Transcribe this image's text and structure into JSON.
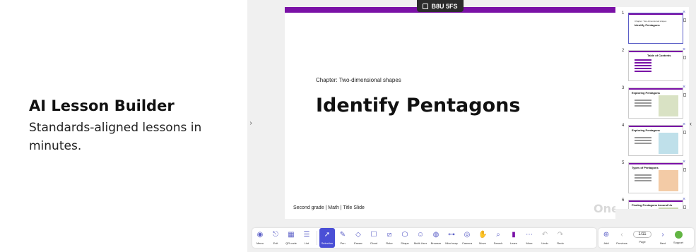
{
  "promo": {
    "title": "AI Lesson Builder",
    "subtitle": "Standards-aligned lessons in minutes."
  },
  "room_code": "B8U 5FS",
  "slide": {
    "chapter": "Chapter: Two-dimensional shapes",
    "title": "Identify Pentagons",
    "footer": "Second grade | Math | Title Slide",
    "logo": "One"
  },
  "thumbnails": [
    {
      "num": "1",
      "chapter": "Chapter: Two-dimensional shapes",
      "title": "Identify Pentagons"
    },
    {
      "num": "2",
      "title": "Table of Contents"
    },
    {
      "num": "3",
      "title": "Exploring Pentagons"
    },
    {
      "num": "4",
      "title": "Exploring Pentagons"
    },
    {
      "num": "5",
      "title": "Types of Pentagons"
    },
    {
      "num": "6",
      "title": "Finding Pentagons Around Us"
    }
  ],
  "toolbar": {
    "menu": "Menu",
    "exit": "Exit",
    "qr_code": "QR code",
    "list": "List",
    "selection": "Selection",
    "pen": "Pen",
    "eraser": "Eraser",
    "cloud": "Cloud",
    "ruler": "Ruler",
    "shape": "Shape",
    "multi_user": "Multi-User",
    "browser": "Browser",
    "mind_map": "Mind map",
    "camera": "Camera",
    "move": "Move",
    "search": "Search",
    "learn": "Learn",
    "more": "More",
    "undo": "Undo",
    "redo": "Redo",
    "add": "Add",
    "previous": "Previous",
    "page_value": "1/11",
    "page": "Page",
    "next": "Next",
    "support": "Support"
  },
  "colors": {
    "accent": "#7a11a6",
    "toolbar_selected": "#4a4fd6",
    "support": "#62b543"
  }
}
